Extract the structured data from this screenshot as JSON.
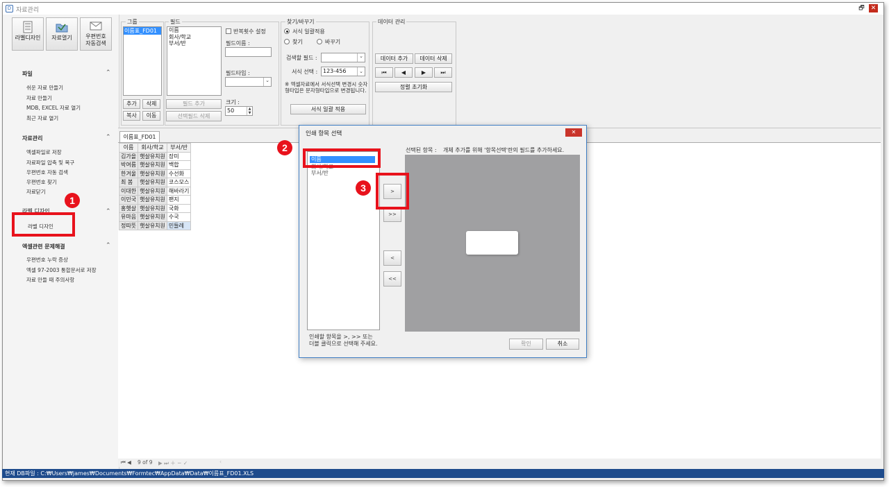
{
  "window": {
    "title": "자료관리",
    "restore_glyph": "🗗",
    "close_glyph": "✕"
  },
  "ribbon": {
    "label_design": "라벨디자인",
    "open_data": "자료열기",
    "zip_search_line1": "우편번호",
    "zip_search_line2": "자동검색"
  },
  "sidebar": {
    "sections": [
      {
        "title": "파일",
        "items": [
          "쉬운 자료 만들기",
          "자료 만들기",
          "MDB, EXCEL 자료 열기",
          "최근 자료 열기"
        ]
      },
      {
        "title": "자료관리",
        "items": [
          "엑셀파일로 저장",
          "자료파일 압축 및 복구",
          "우편번호 자동 검색",
          "우편번호 찾기",
          "자료닫기"
        ]
      },
      {
        "title": "라벨 디자인",
        "items": [
          "라벨 디자인"
        ]
      },
      {
        "title": "엑셀관련 문제해결",
        "items": [
          "우편번호 누락 증상",
          "엑셀 97-2003 통합문서로 저장",
          "자료 만들 때 주의사항"
        ]
      }
    ]
  },
  "group_panel": {
    "title": "그룹",
    "items": [
      "이름표_FD01"
    ],
    "add": "추가",
    "delete": "삭제",
    "copy": "복사",
    "move": "이동"
  },
  "field_panel": {
    "title": "필드",
    "items": [
      "이름",
      "회사/학교",
      "부서/반"
    ],
    "repeat_label": "반복횟수 설정",
    "field_name_label": "필드이름 :",
    "field_type_label": "필드타입 :",
    "size_label": "크기 :",
    "size_value": "50",
    "add_field": "필드 추가",
    "delete_selected": "선택필드 삭제"
  },
  "find_panel": {
    "title": "찾기/바꾸기",
    "opt_apply_all": "서식 일괄적용",
    "opt_find": "찾기",
    "opt_replace": "바꾸기",
    "search_field_label": "검색할 필드 :",
    "format_select_label": "서식 선택 :",
    "format_value": "123-456",
    "note": "※ 엑셀자료에서 서식선택 변경시 숫자형타입은 문자형타입으로 변경됩니다.",
    "apply_button": "서식 일괄 적용"
  },
  "data_panel": {
    "title": "데이터 관리",
    "add_data": "데이터 추가",
    "delete_data": "데이터 삭제",
    "reset_sort": "정렬 초기화"
  },
  "main": {
    "tab": "이름표_FD01",
    "columns": [
      "이름",
      "회사/학교",
      "부서/반"
    ],
    "rows": [
      [
        "김가을",
        "햇살유치원",
        "장미"
      ],
      [
        "박여름",
        "햇살유치원",
        "백합"
      ],
      [
        "한겨울",
        "햇살유치원",
        "수선화"
      ],
      [
        "최 봄",
        "햇살유치원",
        "코스모스"
      ],
      [
        "이대한",
        "햇살유치원",
        "해바라기"
      ],
      [
        "이민국",
        "햇살유치원",
        "팬지"
      ],
      [
        "홍햇살",
        "햇살유치원",
        "국화"
      ],
      [
        "유마음",
        "햇살유치원",
        "수국"
      ],
      [
        "정따뜻",
        "햇살유치원",
        "민들레"
      ]
    ],
    "record_nav": "9 of 9"
  },
  "status": {
    "path": "현재 DB파일 : C:₩Users₩james₩Documents₩Formtec₩AppData₩Data₩이름표_FD01.XLS"
  },
  "dialog": {
    "title": "인쇄 항목 선택",
    "close_glyph": "✕",
    "list_items": [
      "이름",
      "회사/학교",
      "부서/반"
    ],
    "selected_label": "선택된 항목 :",
    "instruction": "개체 추가를 위해 '항목선택'란의 필드를 추가하세요.",
    "move_one": ">",
    "move_all": ">>",
    "remove_one": "<",
    "remove_all": "<<",
    "hint_line1": "인쇄할 항목을  >, >> 또는",
    "hint_line2": "더블 클릭으로 선택해 주세요.",
    "ok": "확인",
    "cancel": "취소"
  },
  "annotations": {
    "badge1": "1",
    "badge2": "2",
    "badge3": "3",
    "color": "#e8121c"
  }
}
